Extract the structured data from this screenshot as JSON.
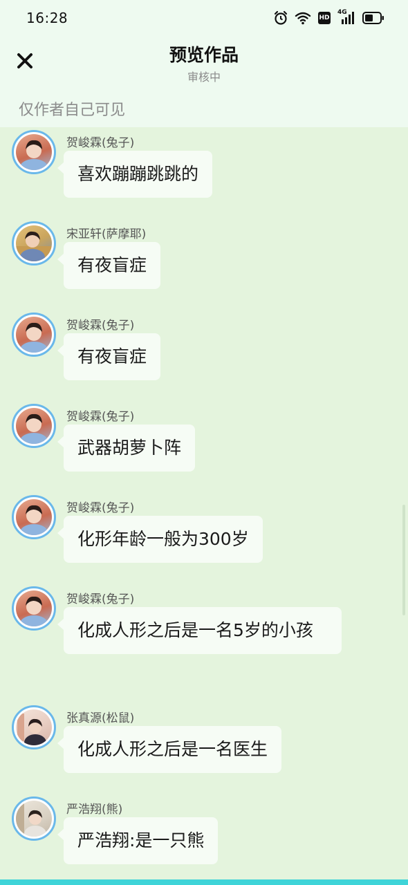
{
  "status_bar": {
    "time": "16:28",
    "icons": [
      "alarm-icon",
      "wifi-icon",
      "hd-icon",
      "4g-signal-icon",
      "battery-icon"
    ],
    "hd_label": "HD",
    "net_label": "4G"
  },
  "header": {
    "title": "预览作品",
    "subtitle": "审核中",
    "visibility_note": "仅作者自己可见",
    "close_icon": "close-icon"
  },
  "colors": {
    "top_background": "#eefaf0",
    "chat_background": "#e4f4dd",
    "bubble": "#f6fcf5",
    "avatar_border": "#6ab8ea",
    "bottom_strip": "#3fd4d8"
  },
  "messages": [
    {
      "name": "贺峻霖(兔子)",
      "text": "喜欢蹦蹦跳跳的"
    },
    {
      "name": "宋亚轩(萨摩耶)",
      "text": "有夜盲症"
    },
    {
      "name": "贺峻霖(兔子)",
      "text": "有夜盲症"
    },
    {
      "name": "贺峻霖(兔子)",
      "text": "武器胡萝卜阵"
    },
    {
      "name": "贺峻霖(兔子)",
      "text": "化形年龄一般为300岁"
    },
    {
      "name": "贺峻霖(兔子)",
      "text": "化成人形之后是一名5岁的小孩"
    },
    {
      "name": "张真源(松鼠)",
      "text": "化成人形之后是一名医生"
    },
    {
      "name": "严浩翔(熊)",
      "text": "严浩翔:是一只熊"
    }
  ]
}
